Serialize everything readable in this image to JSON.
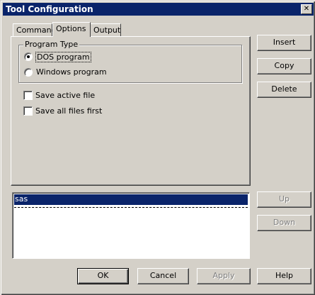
{
  "window": {
    "title": "Tool Configuration",
    "close_glyph": "✕"
  },
  "tabs": [
    {
      "label": "Command",
      "active": false
    },
    {
      "label": "Options",
      "active": true
    },
    {
      "label": "Output",
      "active": false
    }
  ],
  "options": {
    "program_type": {
      "legend": "Program Type",
      "choices": [
        {
          "label": "DOS program",
          "selected": true
        },
        {
          "label": "Windows program",
          "selected": false
        }
      ]
    },
    "checkboxes": [
      {
        "label": "Save active file",
        "checked": false
      },
      {
        "label": "Save all files first",
        "checked": false
      }
    ]
  },
  "side_buttons": {
    "insert": "Insert",
    "copy": "Copy",
    "delete": "Delete",
    "up": "Up",
    "down": "Down"
  },
  "tool_list": {
    "items": [
      "sas"
    ],
    "selected_index": 0
  },
  "footer_buttons": {
    "ok": "OK",
    "cancel": "Cancel",
    "apply": "Apply",
    "help": "Help"
  },
  "colors": {
    "face": "#d4d0c8",
    "titlebar": "#0a246a",
    "selection": "#0a246a",
    "disabled_text": "#808080"
  }
}
